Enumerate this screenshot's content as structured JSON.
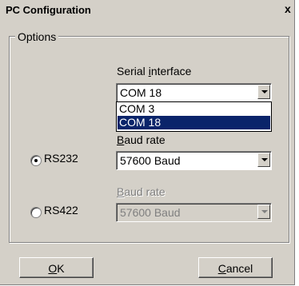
{
  "window": {
    "title": "PC Configuration",
    "close_glyph": "x"
  },
  "options": {
    "group_title": "Options",
    "serial_interface": {
      "label_pre": "Serial ",
      "label_mn": "i",
      "label_post": "nterface",
      "value": "COM 18",
      "dropdown_items": [
        "COM 3",
        "COM 18"
      ],
      "selected_index": 1
    },
    "rs232": {
      "label": "RS232",
      "checked": true,
      "baud_label_mn": "B",
      "baud_label_post": "aud rate",
      "baud_value": "57600 Baud",
      "enabled": true
    },
    "rs422": {
      "label": "RS422",
      "checked": false,
      "baud_label_mn": "B",
      "baud_label_post": "aud rate",
      "baud_value": "57600 Baud",
      "enabled": false
    }
  },
  "buttons": {
    "ok_mn": "O",
    "ok_post": "K",
    "cancel_mn": "C",
    "cancel_post": "ancel"
  },
  "colors": {
    "face": "#d4d0c8",
    "highlight": "#0a246a",
    "disabled_text": "#808080"
  }
}
